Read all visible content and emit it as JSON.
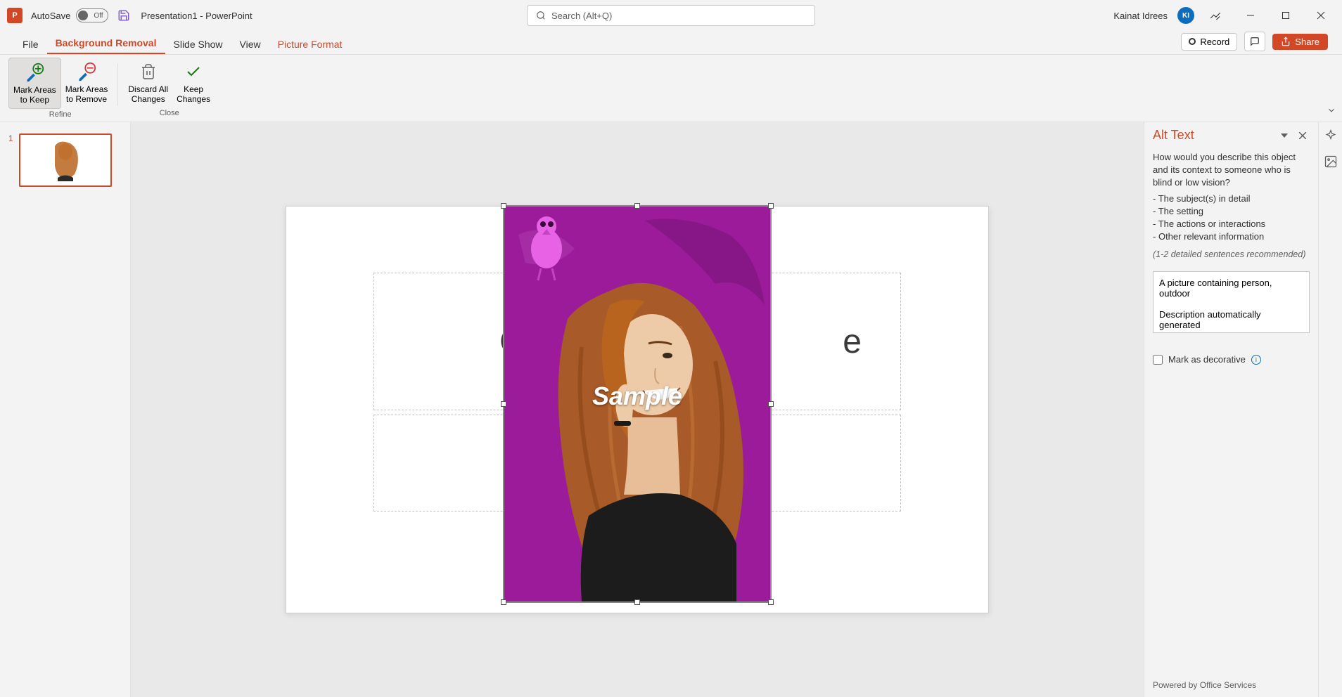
{
  "titlebar": {
    "app_letter": "P",
    "autosave_label": "AutoSave",
    "autosave_state": "Off",
    "doc_title": "Presentation1 - PowerPoint",
    "search_placeholder": "Search (Alt+Q)",
    "user_name": "Kainat Idrees",
    "user_initials": "KI"
  },
  "tabs": {
    "items": [
      {
        "label": "File",
        "active": false,
        "highlight": false
      },
      {
        "label": "Background Removal",
        "active": true,
        "highlight": true
      },
      {
        "label": "Slide Show",
        "active": false,
        "highlight": false
      },
      {
        "label": "View",
        "active": false,
        "highlight": false
      },
      {
        "label": "Picture Format",
        "active": false,
        "highlight": true
      }
    ],
    "record": "Record",
    "share": "Share"
  },
  "ribbon": {
    "refine": {
      "label": "Refine",
      "mark_keep": "Mark Areas\nto Keep",
      "mark_remove": "Mark Areas\nto Remove"
    },
    "close": {
      "label": "Close",
      "discard": "Discard All\nChanges",
      "keep": "Keep\nChanges"
    }
  },
  "thumbs": {
    "slide1_num": "1"
  },
  "canvas": {
    "title_partial_left": "C",
    "title_partial_right": "e",
    "sample_watermark": "Sample"
  },
  "alt_text": {
    "title": "Alt Text",
    "question": "How would you describe this object and its context to someone who is blind or low vision?",
    "bullets": [
      "The subject(s) in detail",
      "The setting",
      "The actions or interactions",
      "Other relevant information"
    ],
    "hint": "(1-2 detailed sentences recommended)",
    "textarea_value": "A picture containing person, outdoor\n\nDescription automatically generated",
    "decorative_label": "Mark as decorative",
    "footer": "Powered by Office Services"
  }
}
